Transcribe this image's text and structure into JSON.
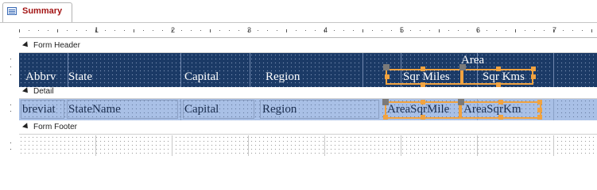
{
  "tab": {
    "title": "Summary",
    "icon": "form-icon"
  },
  "ruler": {
    "numbers": [
      "1",
      "2",
      "3",
      "4",
      "5",
      "6",
      "7"
    ]
  },
  "sections": {
    "form_header": "Form Header",
    "detail": "Detail",
    "form_footer": "Form Footer"
  },
  "header_labels": {
    "abbrv": "Abbrv",
    "state": "State",
    "capital": "Capital",
    "region": "Region",
    "area": "Area",
    "sqr_miles": "Sqr Miles",
    "sqr_kms": "Sqr Kms"
  },
  "detail_fields": {
    "abbrev": "breviat",
    "state_name": "StateName",
    "capital": "Capital",
    "region": "Region",
    "area_sqr_mile": "AreaSqrMile",
    "area_sqr_km": "AreaSqrKm"
  },
  "colors": {
    "header_band": "#1b3a66",
    "detail_band": "#a9c0e6",
    "selection": "#f1a340",
    "tab_label": "#a31515"
  }
}
